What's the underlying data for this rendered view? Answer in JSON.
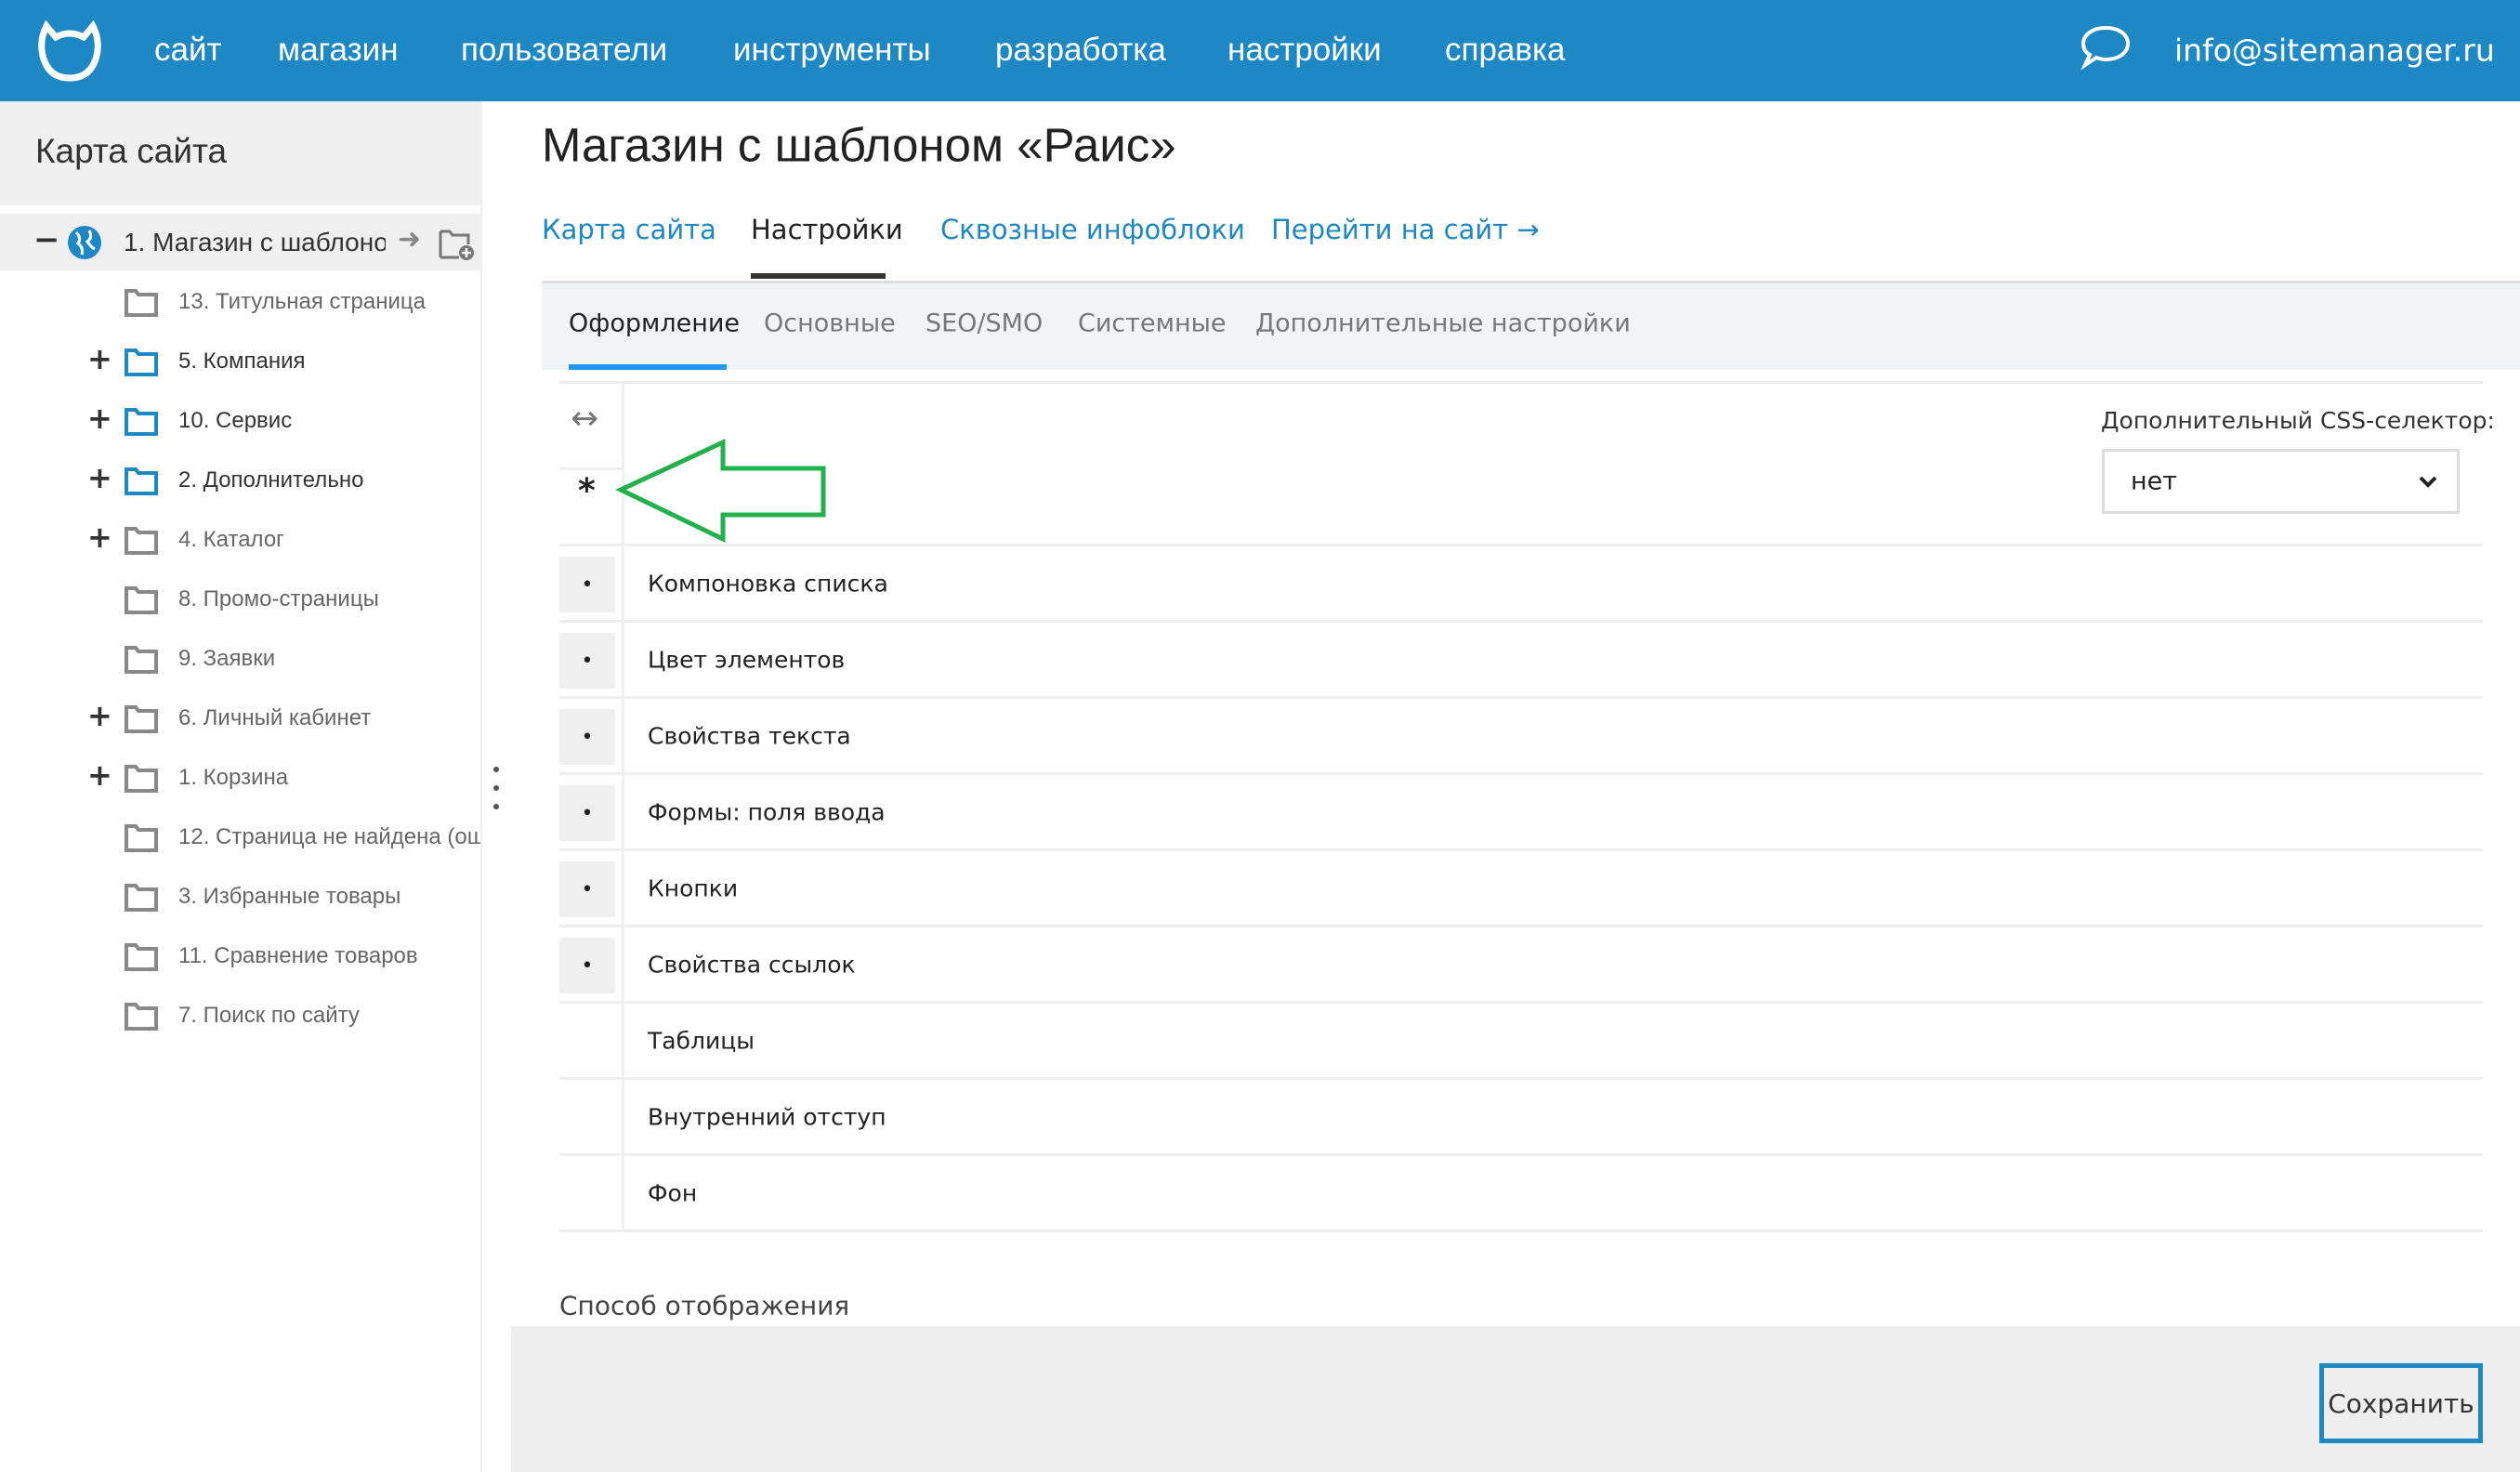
{
  "colors": {
    "brand": "#1e88c4",
    "active_subtab": "#2196f3",
    "annotation_arrow": "#22b14c"
  },
  "topbar": {
    "nav": [
      "сайт",
      "магазин",
      "пользователи",
      "инструменты",
      "разработка",
      "настройки",
      "справка"
    ],
    "email": "info@sitemanager.ru"
  },
  "sidebar": {
    "title": "Карта сайта",
    "root": {
      "label": "1. Магазин с шаблоно",
      "toggle": "−"
    },
    "items": [
      {
        "label": "13. Титульная страница",
        "toggle": "",
        "folder": "gray"
      },
      {
        "label": "5. Компания",
        "toggle": "+",
        "folder": "blue"
      },
      {
        "label": "10. Сервис",
        "toggle": "+",
        "folder": "blue"
      },
      {
        "label": "2. Дополнительно",
        "toggle": "+",
        "folder": "blue"
      },
      {
        "label": "4. Каталог",
        "toggle": "+",
        "folder": "gray"
      },
      {
        "label": "8. Промо-страницы",
        "toggle": "",
        "folder": "gray"
      },
      {
        "label": "9. Заявки",
        "toggle": "",
        "folder": "gray"
      },
      {
        "label": "6. Личный кабинет",
        "toggle": "+",
        "folder": "gray"
      },
      {
        "label": "1. Корзина",
        "toggle": "+",
        "folder": "gray"
      },
      {
        "label": "12. Страница не найдена (ош",
        "toggle": "",
        "folder": "gray"
      },
      {
        "label": "3. Избранные товары",
        "toggle": "",
        "folder": "gray"
      },
      {
        "label": "11. Сравнение товаров",
        "toggle": "",
        "folder": "gray"
      },
      {
        "label": "7. Поиск по сайту",
        "toggle": "",
        "folder": "gray"
      }
    ]
  },
  "main": {
    "title": "Магазин с шаблоном «Раис»",
    "tabs": [
      "Карта сайта",
      "Настройки",
      "Сквозные инфоблоки",
      "Перейти на сайт →"
    ],
    "active_tab": "Настройки",
    "subtabs": [
      "Оформление",
      "Основные",
      "SEO/SMO",
      "Системные",
      "Дополнительные настройки"
    ],
    "active_subtab": "Оформление",
    "icons": {
      "resize": "↔",
      "asterisk": "*"
    },
    "css_selector": {
      "label": "Дополнительный CSS-селектор:",
      "value": "нет"
    },
    "rows": [
      {
        "label": "Компоновка списка",
        "bullet": "•"
      },
      {
        "label": "Цвет элементов",
        "bullet": "•"
      },
      {
        "label": "Свойства текста",
        "bullet": "•"
      },
      {
        "label": "Формы: поля ввода",
        "bullet": "•"
      },
      {
        "label": "Кнопки",
        "bullet": "•"
      },
      {
        "label": "Свойства ссылок",
        "bullet": "•"
      },
      {
        "label": "Таблицы",
        "bullet": ""
      },
      {
        "label": "Внутренний отступ",
        "bullet": ""
      },
      {
        "label": "Фон",
        "bullet": ""
      }
    ],
    "section_title": "Способ отображения",
    "save_label": "Сохранить"
  }
}
